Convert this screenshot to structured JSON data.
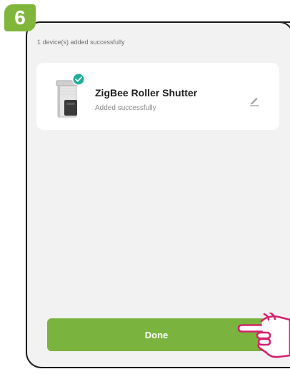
{
  "step": {
    "number": "6"
  },
  "header": {
    "status_text": "1 device(s) added successfully"
  },
  "device": {
    "name": "ZigBee Roller Shutter",
    "status": "Added successfully",
    "image_icon": "roller-shutter-icon",
    "badge_icon": "check-badge-icon",
    "edit_icon": "pencil-icon"
  },
  "actions": {
    "done_label": "Done"
  },
  "hint": {
    "icon": "pointing-hand-icon"
  },
  "colors": {
    "accent_green": "#7ab33d",
    "badge_green": "#80b63b",
    "check_teal": "#1fae9a",
    "hand_pink": "#d4216e",
    "background": "#f2f2f2",
    "card": "#ffffff"
  }
}
